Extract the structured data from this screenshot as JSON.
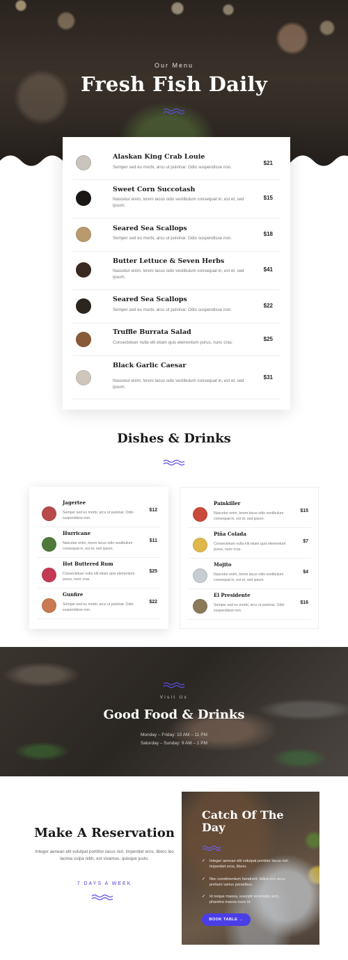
{
  "hero": {
    "label": "Our Menu",
    "title": "Fresh Fish Daily"
  },
  "menu": [
    {
      "name": "Alaskan King Crab Louie",
      "desc": "Semper sed eu morbi, arcu ut pulvinar. Odio suspendisse non.",
      "price": "$21",
      "thumb": "#c9c4bd"
    },
    {
      "name": "Sweet Corn Succotash",
      "desc": "Nascetur enim, lorem lacus odio vestibulum consequat in, est et, sed ipsum.",
      "price": "$15",
      "thumb": "#1a1715"
    },
    {
      "name": "Seared Sea Scallops",
      "desc": "Semper sed eu morbi, arcu ut pulvinar. Odio suspendisse non.",
      "price": "$18",
      "thumb": "#b99a6e"
    },
    {
      "name": "Butter Lettuce & Seven Herbs",
      "desc": "Nascetur enim, lorem lacus odio vestibulum consequat in, est et, sed ipsum.",
      "price": "$41",
      "thumb": "#3b2a21"
    },
    {
      "name": "Seared Sea Scallops",
      "desc": "Semper sed eu morbi, arcu ut pulvinar. Odio suspendisse non.",
      "price": "$22",
      "thumb": "#2b2520"
    },
    {
      "name": "Truffle Burrata Salad",
      "desc": "Consectetuer nulla elit etiam quis elementum purus, nunc cras.",
      "price": "$25",
      "thumb": "#8a5a38"
    },
    {
      "name": "Black Garlic Caesar",
      "desc": "Nascetur enim, lorem lacus odio vestibulum consequat in, est et, sed ipsum.",
      "price": "$31",
      "thumb": "#cfc6bb"
    }
  ],
  "dishes_title": "Dishes & Drinks",
  "drinks_left": [
    {
      "name": "Jagertee",
      "desc": "Semper sed eu morbi, arcu ut pulvinar. Odio suspendisse non.",
      "price": "$12",
      "thumb": "#b84a4a"
    },
    {
      "name": "Hurricane",
      "desc": "Nascetur enim, lorem lacus odio vestibulum consequat in, est et, sed ipsum.",
      "price": "$11",
      "thumb": "#4f7a3a"
    },
    {
      "name": "Hot Buttered Rum",
      "desc": "Consectetuer nulla elit etiam quis elementum purus, nunc cras.",
      "price": "$25",
      "thumb": "#c43a55"
    },
    {
      "name": "Gunfire",
      "desc": "Semper sed eu morbi, arcu ut pulvinar. Odio suspendisse non.",
      "price": "$22",
      "thumb": "#c97a50"
    }
  ],
  "drinks_right": [
    {
      "name": "Painkiller",
      "desc": "Nascetur enim, lorem lacus odio vestibulum consequat in, est et, sed ipsum.",
      "price": "$15",
      "thumb": "#c94a3a"
    },
    {
      "name": "Piña Colada",
      "desc": "Consectetuer nulla elit etiam quis elementum purus, nunc cras.",
      "price": "$7",
      "thumb": "#e0b84a"
    },
    {
      "name": "Mojito",
      "desc": "Nascetur enim, lorem lacus odio vestibulum consequat in, est et, sed ipsum.",
      "price": "$4",
      "thumb": "#c8cdd2"
    },
    {
      "name": "El Presidente",
      "desc": "Semper sed eu morbi, arcu ut pulvinar. Odio suspendisse non.",
      "price": "$16",
      "thumb": "#8a7a5a"
    }
  ],
  "visit": {
    "label": "Visit Us",
    "title": "Good Food & Drinks",
    "hours": [
      "Monday – Friday: 10 AM – 11 PM",
      "Saturday – Sunday: 9 AM – 1 PM"
    ]
  },
  "reservation": {
    "title": "Make A Reservation",
    "text": "Integer aenean elit volutpat porttitor lacus nisl. Imperdiet eros, libero leo lacinia culpa nibh, est vivamus, quisque justo.",
    "link": "7 DAYS A WEEK"
  },
  "catch": {
    "title": "Catch Of The Day",
    "items": [
      "Integer aenean elit volutpat porttitor lacus nisl. Imperdiet eros, libero.",
      "Nec condimentum hendrerit, tellus orci arcu, pretium varius penatibus.",
      "Id neque massa, suscipit venenatis sem, pharetra massa nunc id."
    ],
    "button": "BOOK TABLE →"
  },
  "colors": {
    "accent": "#4b3ee6",
    "squiggle": "#5a4fe0"
  }
}
